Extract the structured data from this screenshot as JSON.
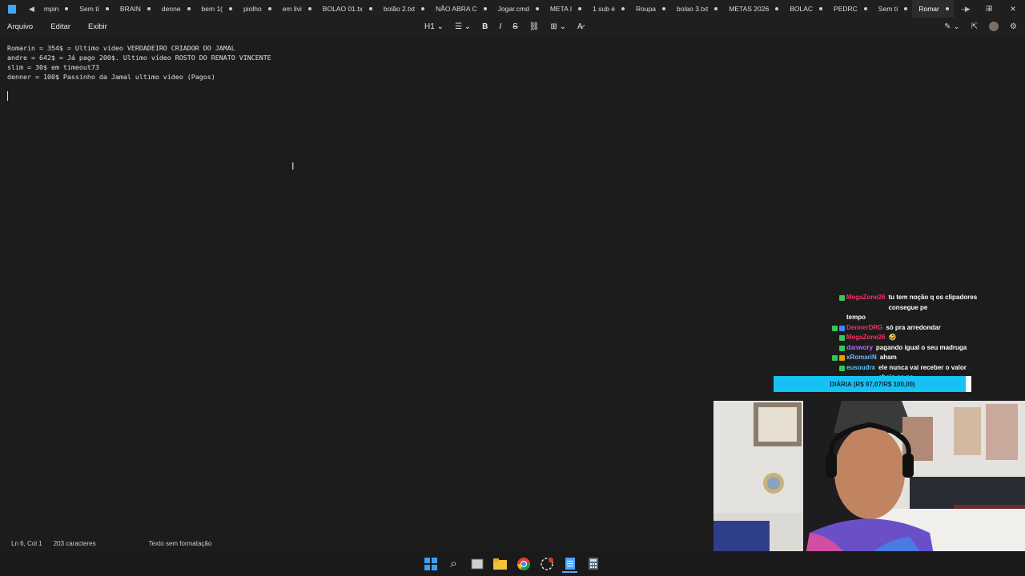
{
  "tabs": [
    {
      "label": "mpin"
    },
    {
      "label": "Sem tí"
    },
    {
      "label": "BRAIN"
    },
    {
      "label": "denne"
    },
    {
      "label": "bem 1("
    },
    {
      "label": "piolho"
    },
    {
      "label": "em livi"
    },
    {
      "label": "BOLAO 01.tx"
    },
    {
      "label": "bolão 2.txt"
    },
    {
      "label": "NÃO ABRA C"
    },
    {
      "label": "Jogar.cmd"
    },
    {
      "label": "META I"
    },
    {
      "label": "1 sub é"
    },
    {
      "label": "Roupa"
    },
    {
      "label": "bolao 3.txt"
    },
    {
      "label": "METAS 2026"
    },
    {
      "label": "BOLAC"
    },
    {
      "label": "PEDRC"
    },
    {
      "label": "Sem tí"
    },
    {
      "label": "Romar",
      "active": true
    }
  ],
  "menu": {
    "file": "Arquivo",
    "edit": "Editar",
    "view": "Exibir"
  },
  "toolbar": {
    "heading": "H1"
  },
  "editor": {
    "lines": [
      "Romarin = 354$ = Ultimo vídeo VERDADEIRO CRIADOR DO JAMAL",
      "andre = 642$ = Já pago 200$. Ultimo vídeo ROSTO DO RENATO VINCENTE",
      "slim = 30$ em timeout73",
      "denner = 100$ Passinho da Jamal ultimo vídeo (Pagos)"
    ]
  },
  "status": {
    "position": "Ln 6, Col 1",
    "chars": "203 caracteres",
    "format": "Texto sem formatação"
  },
  "chat": [
    {
      "user": "MegaZone26",
      "color": "#ff2e63",
      "badges": [
        "#34c759"
      ],
      "message": "tu tem noção q os clipadores consegue pe"
    },
    {
      "user": "",
      "color": "#ffffff",
      "badges": [],
      "message": "tempo"
    },
    {
      "user": "DennerDRG",
      "color": "#ff2e63",
      "badges": [
        "#34c759",
        "#3a8df5"
      ],
      "message": "só pra arredondar"
    },
    {
      "user": "MegaZone26",
      "color": "#ff2e63",
      "badges": [
        "#34c759"
      ],
      "message": "🤣"
    },
    {
      "user": "danwory",
      "color": "#b36cff",
      "badges": [
        "#34c759"
      ],
      "message": "pagando igual o seu madruga"
    },
    {
      "user": "xRomariN",
      "color": "#6fb8ff",
      "badges": [
        "#34c759",
        "#e1a100"
      ],
      "message": "aham"
    },
    {
      "user": "eusoudrx",
      "color": "#5bc8ff",
      "badges": [
        "#34c759"
      ],
      "message": "ele nunca vai receber o valor cheio se pa"
    }
  ],
  "daily_goal": {
    "label": "DIÁRIA (R$ 97,07/R$ 100,00)",
    "progress": 0.9707,
    "color": "#16c1f3"
  }
}
